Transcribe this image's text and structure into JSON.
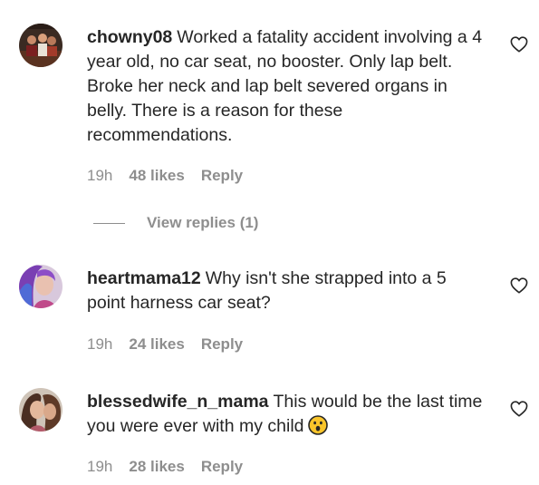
{
  "comments": [
    {
      "username": "chowny08",
      "text": "Worked a fatality accident involving a 4 year old, no car seat, no booster. Only lap belt. Broke her neck and lap belt severed organs in belly. There is a reason for these recommendations.",
      "time": "19h",
      "likes": "48 likes",
      "reply": "Reply",
      "avatar_icon": "user-avatar-photo"
    },
    {
      "username": "heartmama12",
      "text": "Why isn't she strapped into a 5 point harness car seat?",
      "time": "19h",
      "likes": "24 likes",
      "reply": "Reply",
      "avatar_icon": "user-avatar-photo"
    },
    {
      "username": "blessedwife_n_mama",
      "text": "This would be the last time you were ever with my child",
      "emoji": "surprised-face-emoji",
      "time": "19h",
      "likes": "28 likes",
      "reply": "Reply",
      "avatar_icon": "user-avatar-photo"
    }
  ],
  "view_replies": {
    "label": "View replies (1)"
  },
  "colors": {
    "text": "#262626",
    "muted": "#8e8e8e",
    "emoji_yellow": "#f9c52b"
  }
}
